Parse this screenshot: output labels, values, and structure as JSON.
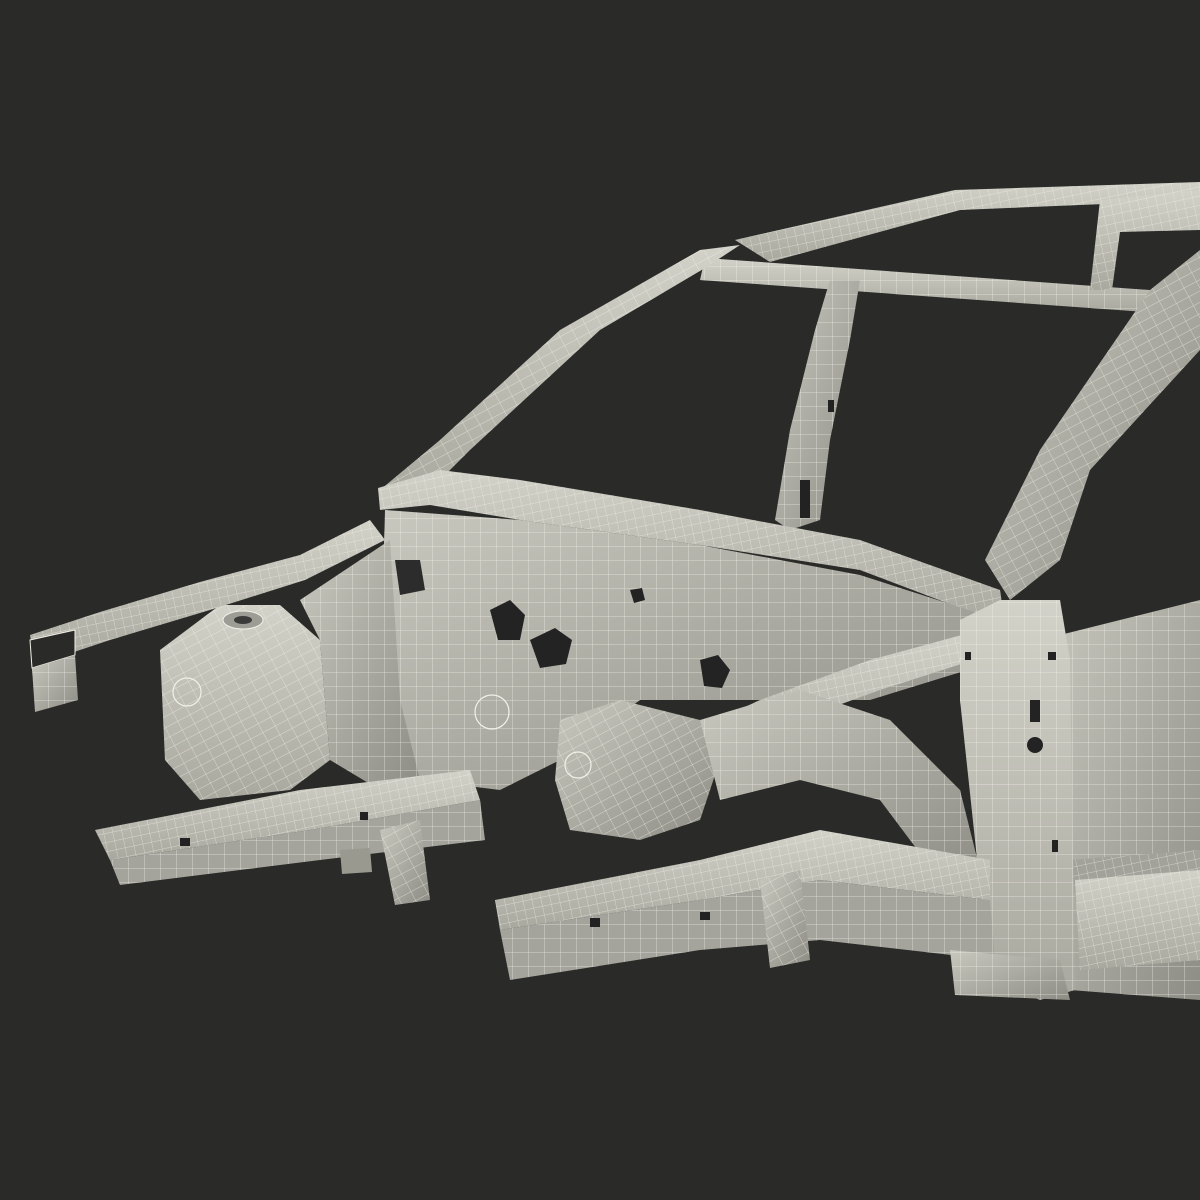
{
  "scene": {
    "background": "#2a2a28",
    "surface_color": "#bfbeb4",
    "surface_light": "#d4d3ca",
    "surface_shadow": "#8f8e86",
    "wire_color": "#f2f1e8",
    "hole_color": "#222222"
  }
}
